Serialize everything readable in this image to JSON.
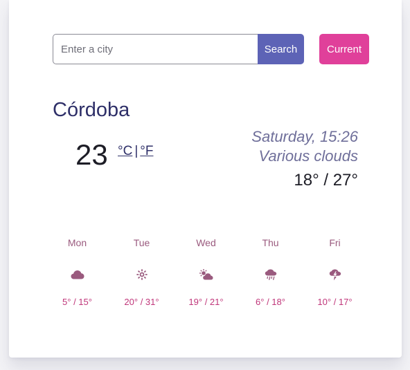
{
  "search": {
    "placeholder": "Enter a city",
    "value": "",
    "search_label": "Search",
    "current_label": "Current"
  },
  "weather": {
    "city": "Córdoba",
    "temperature": "23",
    "unit_celsius": "°C",
    "unit_separator": "|",
    "unit_fahrenheit": "°F",
    "datetime": "Saturday, 15:26",
    "description": "Various clouds",
    "min_max": "18° / 27°"
  },
  "forecast": [
    {
      "day": "Mon",
      "icon": "cloud-icon",
      "temps": "5° / 15°"
    },
    {
      "day": "Tue",
      "icon": "sun-icon",
      "temps": "20° / 31°"
    },
    {
      "day": "Wed",
      "icon": "partly-cloudy-icon",
      "temps": "19° / 21°"
    },
    {
      "day": "Thu",
      "icon": "rain-icon",
      "temps": "6° / 18°"
    },
    {
      "day": "Fri",
      "icon": "thunderstorm-icon",
      "temps": "10° / 17°"
    }
  ],
  "colors": {
    "primary": "#5d63b6",
    "accent": "#e0409a",
    "city_text": "#2e2f68",
    "forecast_day": "#9a5a7e",
    "forecast_temp": "#c0367a",
    "forecast_icon": "#9a5a7e"
  }
}
